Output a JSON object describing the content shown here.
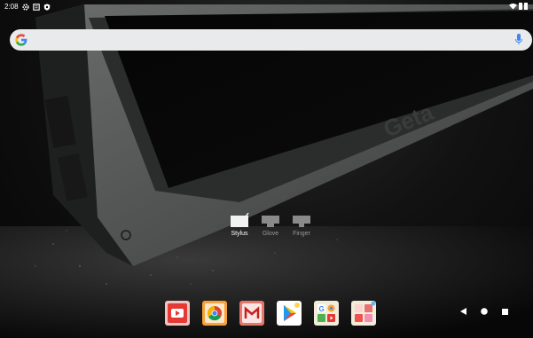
{
  "status_bar": {
    "time": "2:08",
    "icons": [
      "gear-icon",
      "clipboard-icon",
      "shield-icon",
      "wifi-icon",
      "signal-icon",
      "battery-icon"
    ]
  },
  "search": {
    "logo": "google-icon",
    "mic_icon": "mic-icon"
  },
  "wallpaper": {
    "brand_text": "Geta"
  },
  "input_modes": [
    {
      "label": "Stylus",
      "icon": "stylus-icon",
      "active": true
    },
    {
      "label": "Glove",
      "icon": "glove-icon",
      "active": false
    },
    {
      "label": "Finger",
      "icon": "finger-icon",
      "active": false
    }
  ],
  "dock": {
    "apps": [
      "youtube-app",
      "chrome-app",
      "gmail-app",
      "play-store-app",
      "google-folder",
      "tools-folder"
    ]
  },
  "nav_bar": {
    "icons": [
      "back-icon",
      "home-icon",
      "recents-icon"
    ]
  },
  "colors": {
    "search_bg": "#e9eaec",
    "youtube": "#e53935",
    "chrome_frame": "#f6a13a",
    "gmail_frame": "#e5786c",
    "play_frame": "#ffffff",
    "accent_blue": "#4285f4"
  }
}
